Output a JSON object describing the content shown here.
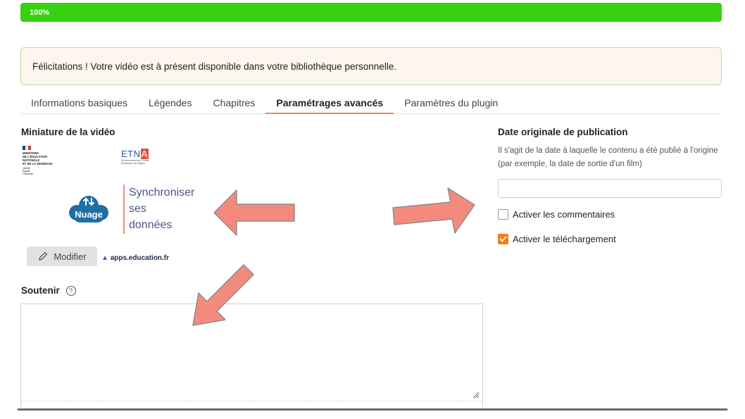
{
  "progress": {
    "label": "100%",
    "value": 100,
    "color": "#37d10f"
  },
  "alert": {
    "message": "Félicitations ! Votre vidéo est à présent disponible dans votre bibliothèque personnelle."
  },
  "tabs": [
    {
      "label": "Informations basiques",
      "active": false
    },
    {
      "label": "Légendes",
      "active": false
    },
    {
      "label": "Chapitres",
      "active": false
    },
    {
      "label": "Paramétrages avancés",
      "active": true
    },
    {
      "label": "Paramètres du plugin",
      "active": false
    }
  ],
  "thumbnail": {
    "title": "Miniature de la vidéo",
    "ministere_lines": [
      "MINISTÈRE",
      "DE L'ÉDUCATION",
      "NATIONALE",
      "ET DE LA JEUNESSE",
      "Liberté",
      "Égalité",
      "Fraternité"
    ],
    "etna_logo": "ETNA",
    "etna_subtitle": "Environnement de Travail Numérique de l'Agent",
    "nuage_label": "Nuage",
    "sync_lines": [
      "Synchroniser",
      "ses",
      "données"
    ],
    "modify_label": "Modifier",
    "apps_logo": "apps.education.fr"
  },
  "support": {
    "title": "Soutenir",
    "help_glyph": "?"
  },
  "publication": {
    "title": "Date originale de publication",
    "help": "Il s'agit de la date à laquelle le contenu a été publié à l'origine (par exemple, la date de sortie d'un film)",
    "date_value": ""
  },
  "options": {
    "comments_label": "Activer les commentaires",
    "comments_checked": false,
    "download_label": "Activer le téléchargement",
    "download_checked": true
  },
  "colors": {
    "accent_tab": "#f08a4b",
    "checkbox_checked": "#f07f1e",
    "annotation_arrow": "#f48a7d",
    "alert_border": "#b9df9a",
    "alert_bg": "#fdf6ec"
  },
  "icons": [
    "pencil-icon",
    "help-circle-icon",
    "check-icon",
    "resize-grip-icon",
    "cloud-icon",
    "arrow-left-annotation",
    "arrow-right-annotation",
    "arrow-down-left-annotation"
  ]
}
